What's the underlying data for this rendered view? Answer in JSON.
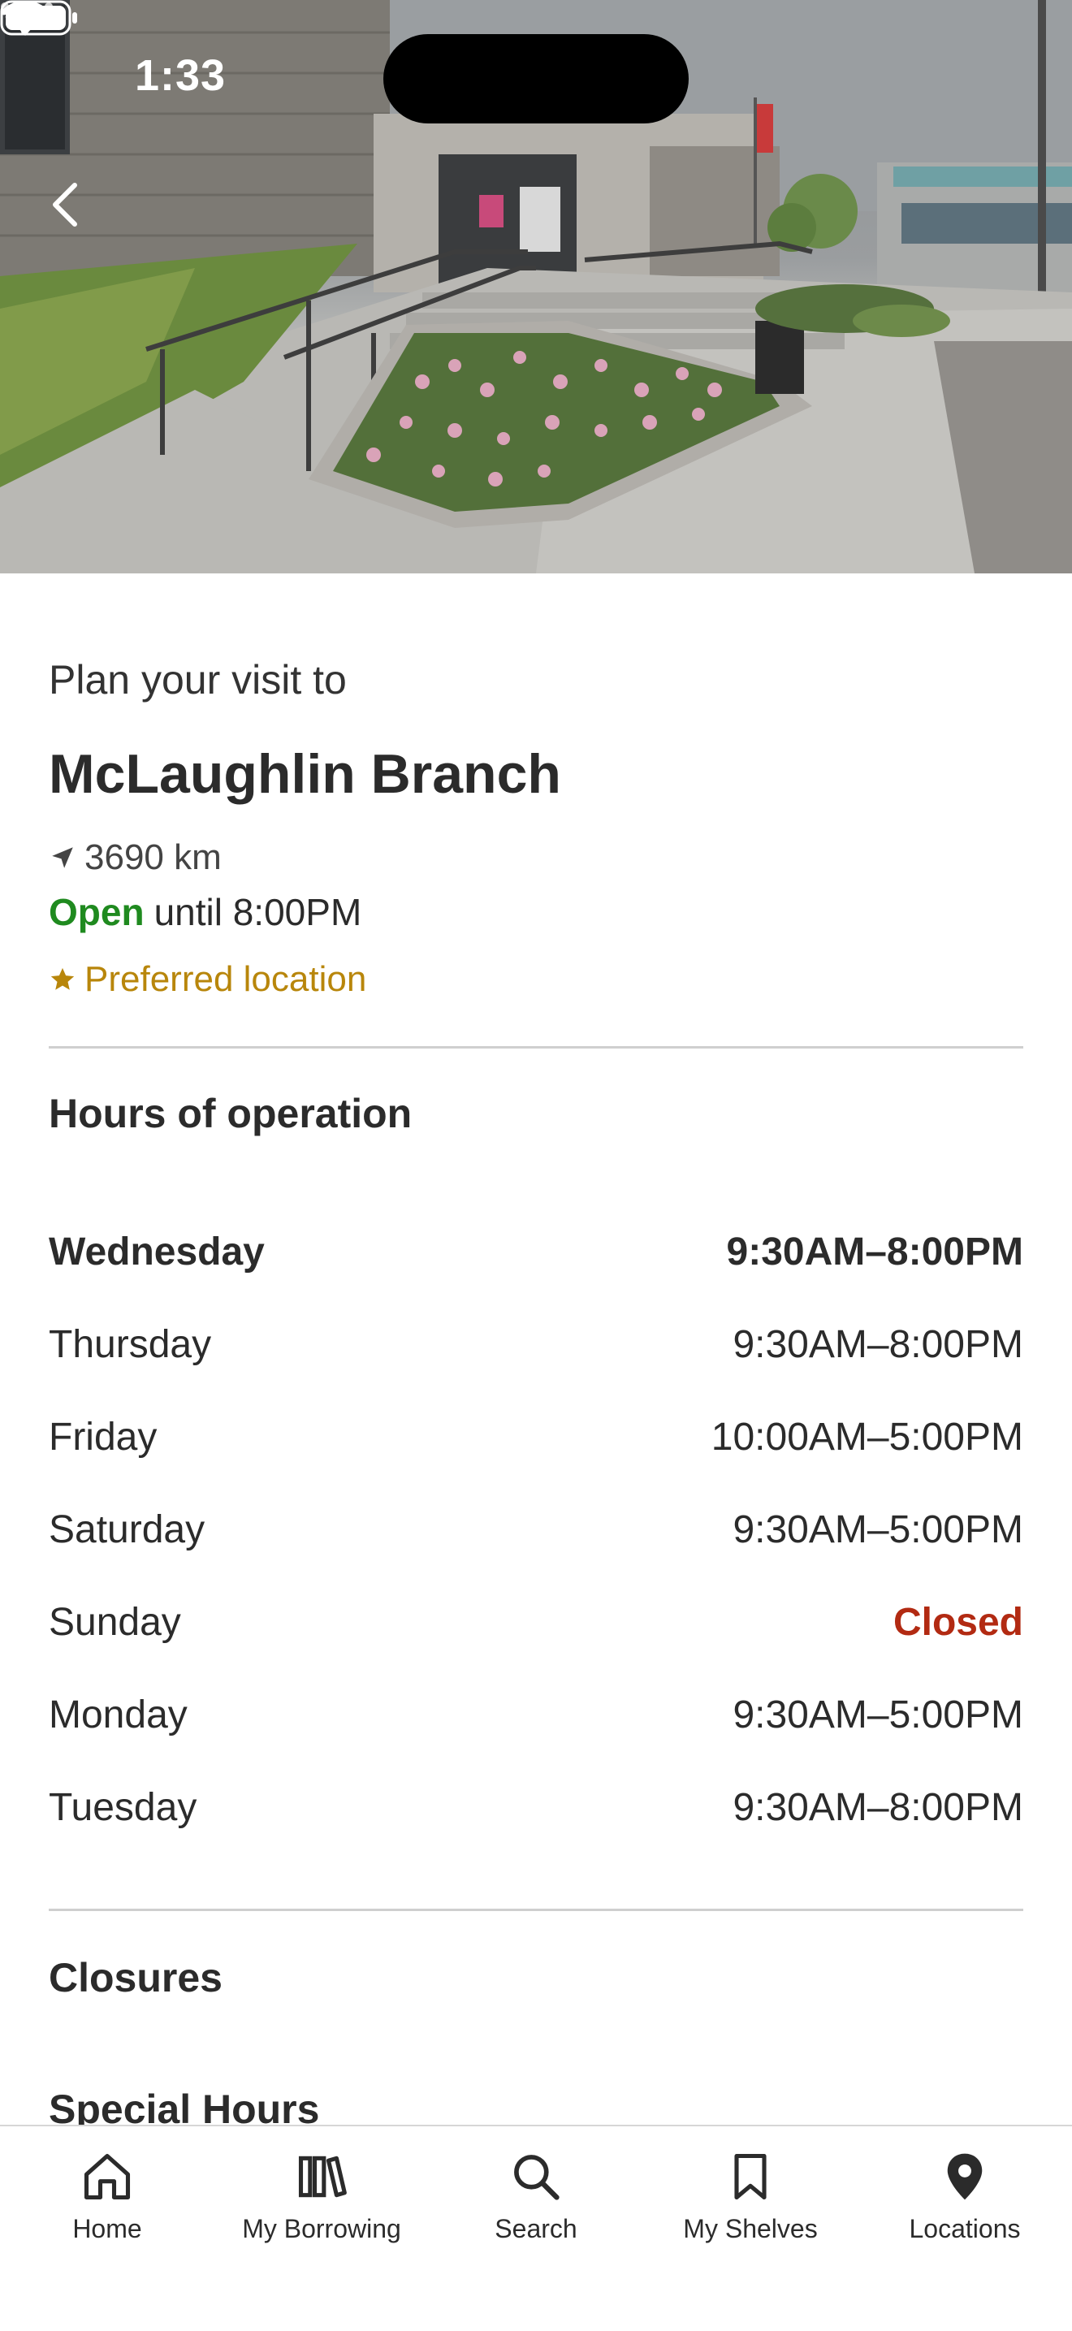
{
  "status_bar": {
    "time": "1:33"
  },
  "header": {
    "subtitle": "Plan your visit to",
    "branch_name": "McLaughlin Branch",
    "distance": "3690 km",
    "open_status": "Open",
    "open_until": "until 8:00PM",
    "preferred_label": "Preferred location"
  },
  "hours": {
    "heading": "Hours of operation",
    "rows": [
      {
        "day": "Wednesday",
        "time": "9:30AM–8:00PM"
      },
      {
        "day": "Thursday",
        "time": "9:30AM–8:00PM"
      },
      {
        "day": "Friday",
        "time": "10:00AM–5:00PM"
      },
      {
        "day": "Saturday",
        "time": "9:30AM–5:00PM"
      },
      {
        "day": "Sunday",
        "time": "Closed"
      },
      {
        "day": "Monday",
        "time": "9:30AM–5:00PM"
      },
      {
        "day": "Tuesday",
        "time": "9:30AM–8:00PM"
      }
    ]
  },
  "closures": {
    "heading": "Closures"
  },
  "special_hours": {
    "heading": "Special Hours"
  },
  "tabs": [
    {
      "label": "Home",
      "icon": "home-icon"
    },
    {
      "label": "My Borrowing",
      "icon": "books-icon"
    },
    {
      "label": "Search",
      "icon": "search-icon"
    },
    {
      "label": "My Shelves",
      "icon": "bookmark-icon"
    },
    {
      "label": "Locations",
      "icon": "location-pin-icon"
    }
  ],
  "colors": {
    "open": "#1f8a1f",
    "preferred": "#b8860b",
    "closed": "#b22a12",
    "text": "#2b2b2b"
  }
}
